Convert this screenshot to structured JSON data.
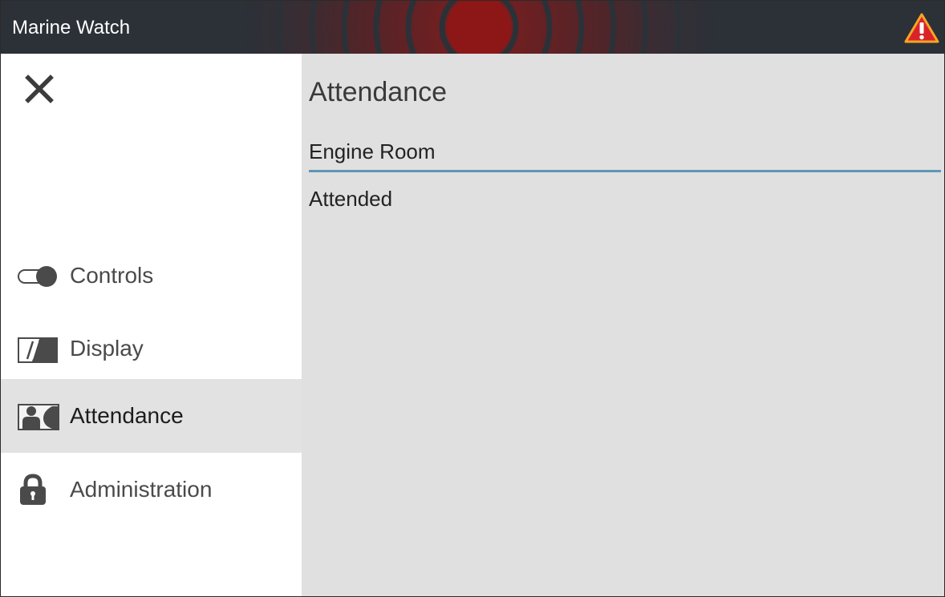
{
  "window": {
    "title": "Marine Watch"
  },
  "header": {
    "warning_icon": "warning-triangle-icon",
    "alarm_color": "#8b1a1a"
  },
  "sidebar": {
    "close_icon": "close-icon",
    "items": [
      {
        "label": "Controls",
        "icon": "toggle-icon",
        "active": false
      },
      {
        "label": "Display",
        "icon": "display-icon",
        "active": false
      },
      {
        "label": "Attendance",
        "icon": "attendance-icon",
        "active": true
      },
      {
        "label": "Administration",
        "icon": "lock-icon",
        "active": false
      }
    ]
  },
  "main": {
    "title": "Attendance",
    "section": "Engine Room",
    "status": "Attended"
  },
  "colors": {
    "titlebar": "#2c3138",
    "accent": "#5f97b5",
    "panel": "#e0e0e0",
    "active_nav": "#e2e2e2",
    "warning": "#d9232a",
    "warning_border": "#f5a623"
  }
}
